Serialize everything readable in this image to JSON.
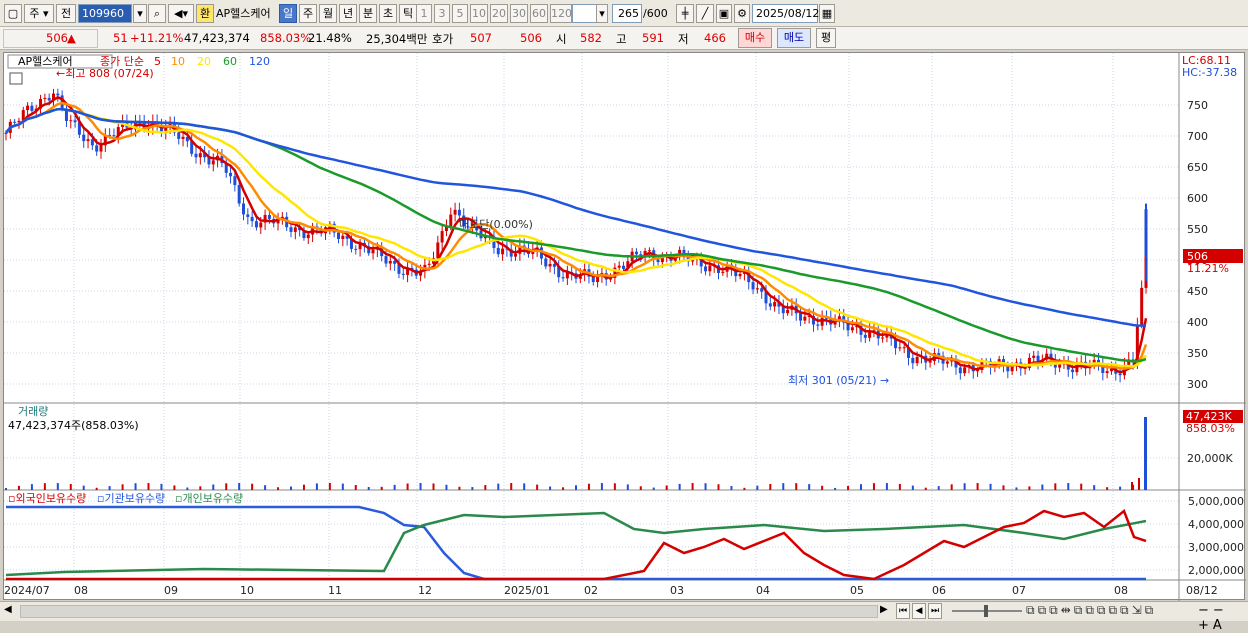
{
  "toolbar": {
    "mode_label": "주",
    "mode_label2": "전",
    "code": "109960",
    "exchange_label": "환",
    "stock_name": "AP헬스케어",
    "periods": [
      "일",
      "주",
      "월",
      "년",
      "분",
      "초",
      "틱"
    ],
    "active_period": "일",
    "minutes": [
      "1",
      "3",
      "5",
      "10",
      "20",
      "30",
      "60",
      "120"
    ],
    "range": "265",
    "range_max": "/600",
    "date": "2025/08/12"
  },
  "infobar": {
    "price": "506",
    "change_arrow": "▲",
    "change": "51",
    "change_pct": "+11.21%",
    "volume": "47,423,374",
    "volume_ratio": "858.03%",
    "turnover": "21.48%",
    "amount": "25,304백만",
    "quote_label": "호가",
    "bid": "507",
    "ask": "506",
    "open_label": "시",
    "open": "582",
    "high_label": "고",
    "high": "591",
    "low_label": "저",
    "low": "466",
    "buy_label": "매수",
    "sell_label": "매도",
    "eval_label": "평"
  },
  "price_panel": {
    "legend_name": "AP헬스케어",
    "legend_ma": "종가 단순",
    "ma_periods": [
      "5",
      "10",
      "20",
      "60",
      "120"
    ],
    "ma_colors": [
      "#d40000",
      "#ff8c00",
      "#ffe600",
      "#1a9a2a",
      "#2255dd"
    ],
    "lc": "LC:68.11",
    "hc": "HC:-37.38",
    "max_label": "최고 808 (07/24)",
    "min_label": "최저 301 (05/21)",
    "ann": "매도단(0.00%)",
    "current_label": "506",
    "current_pct": "11.21%",
    "y_ticks": [
      "750",
      "700",
      "650",
      "600",
      "550",
      "500",
      "450",
      "400",
      "350",
      "300"
    ]
  },
  "volume_panel": {
    "title": "거래량",
    "value": "47,423,374주(858.03%)",
    "current": "47,423K",
    "current_pct": "858.03%",
    "tick": "20,000K"
  },
  "holding_panel": {
    "legend": [
      "외국인보유수량",
      "기관보유수량",
      "개인보유수량"
    ],
    "legend_colors": [
      "#d40000",
      "#2255dd",
      "#2a8a4a"
    ],
    "y_ticks": [
      "5,000,000",
      "4,000,000",
      "3,000,000",
      "2,000,000"
    ]
  },
  "x_axis": [
    "2024/07",
    "08",
    "09",
    "10",
    "11",
    "12",
    "2025/01",
    "02",
    "03",
    "04",
    "05",
    "06",
    "07",
    "08"
  ],
  "x_last": "08/12"
}
